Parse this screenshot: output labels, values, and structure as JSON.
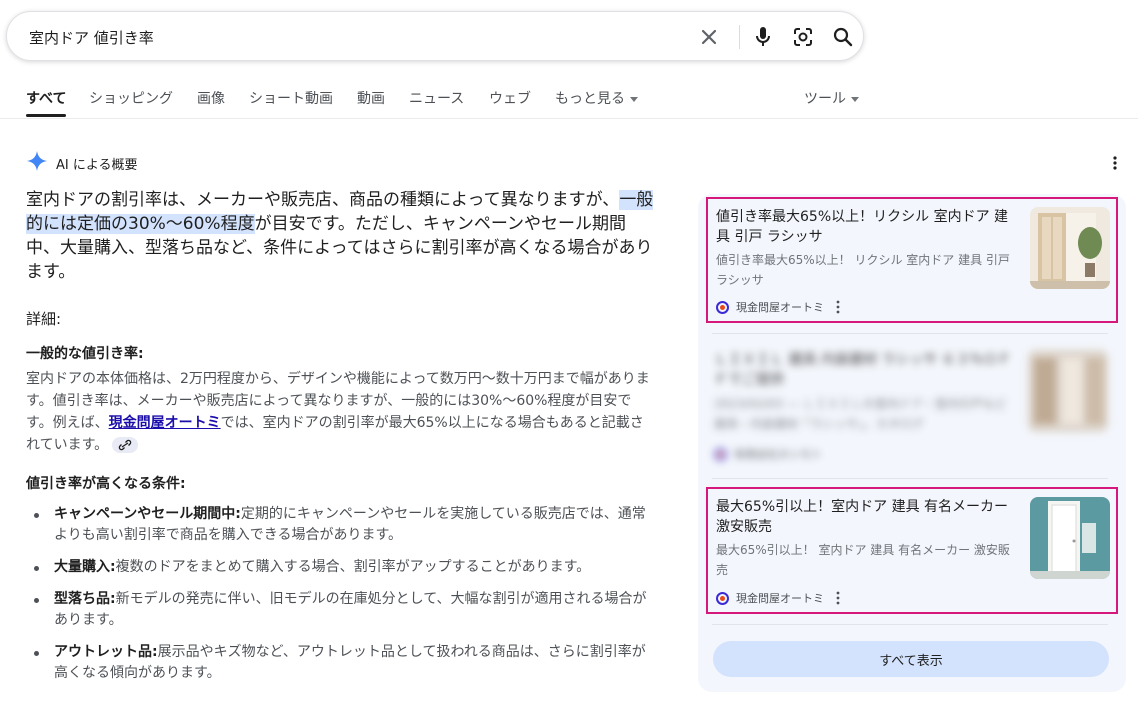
{
  "search": {
    "query": "室内ドア 値引き率"
  },
  "icons": {
    "clear": "close-icon",
    "voice": "mic-icon",
    "lens": "camera-lens-icon",
    "search": "search-icon",
    "ai": "sparkle-icon"
  },
  "tabs": [
    {
      "label": "すべて",
      "active": true
    },
    {
      "label": "ショッピング"
    },
    {
      "label": "画像"
    },
    {
      "label": "ショート動画"
    },
    {
      "label": "動画"
    },
    {
      "label": "ニュース"
    },
    {
      "label": "ウェブ"
    },
    {
      "label": "もっと見る"
    },
    {
      "label": "ツール"
    }
  ],
  "ai_overview": {
    "label": "AI による概要",
    "intro_before": "室内ドアの割引率は、メーカーや販売店、商品の種類によって異なりますが、",
    "intro_highlight": "一般的には定価の30%〜60%程度",
    "intro_after": "が目安です。ただし、キャンペーンやセール期間中、大量購入、型落ち品など、条件によってはさらに割引率が高くなる場合があります。",
    "details_heading": "詳細:",
    "general_heading": "一般的な値引き率:",
    "general_before": "室内ドアの本体価格は、2万円程度から、デザインや機能によって数万円〜数十万円まで幅があります。値引き率は、メーカーや販売店によって異なりますが、一般的には30%〜60%程度が目安です。例えば、",
    "general_link": "現金問屋オートミ",
    "general_after": "では、室内ドアの割引率が最大65%以上になる場合もあると記載されています。",
    "conditions_heading": "値引き率が高くなる条件:",
    "conditions": [
      {
        "term": "キャンペーンやセール期間中:",
        "text": "定期的にキャンペーンやセールを実施している販売店では、通常よりも高い割引率で商品を購入できる場合があります。"
      },
      {
        "term": "大量購入:",
        "text": "複数のドアをまとめて購入する場合、割引率がアップすることがあります。"
      },
      {
        "term": "型落ち品:",
        "text": "新モデルの発売に伴い、旧モデルの在庫処分として、大幅な割引が適用される場合があります。"
      },
      {
        "term": "アウトレット品:",
        "text": "展示品やキズ物など、アウトレット品として扱われる商品は、さらに割引率が高くなる傾向があります。"
      }
    ]
  },
  "sources": {
    "cards": [
      {
        "title": "値引き率最大65%以上！リクシル 室内ドア 建具 引戸 ラシッサ",
        "desc": "値引き率最大65%以上！ リクシル 室内ドア 建具 引戸 ラシッサ",
        "site": "現金問屋オートミ"
      },
      {
        "title": "ＬＩＸＩＬ 建具 内装建材 ラシッサ ６３％ＯＦＦでご提供",
        "desc": "2023/02/03 — ＬＩＸＩＬの室内ドア・室内引戸など建具・内装建材「ラシッサ」。カタログ",
        "site": "有限会社ホシモト"
      },
      {
        "title": "最大65%引以上！室内ドア 建具 有名メーカー 激安販売",
        "desc": "最大65%引以上！ 室内ドア 建具 有名メーカー 激安販売",
        "site": "現金問屋オートミ"
      }
    ],
    "show_all": "すべて表示"
  },
  "colors": {
    "highlight_box": "#d6177c",
    "ai_star": "#4285f4",
    "link": "#1a0dab"
  }
}
